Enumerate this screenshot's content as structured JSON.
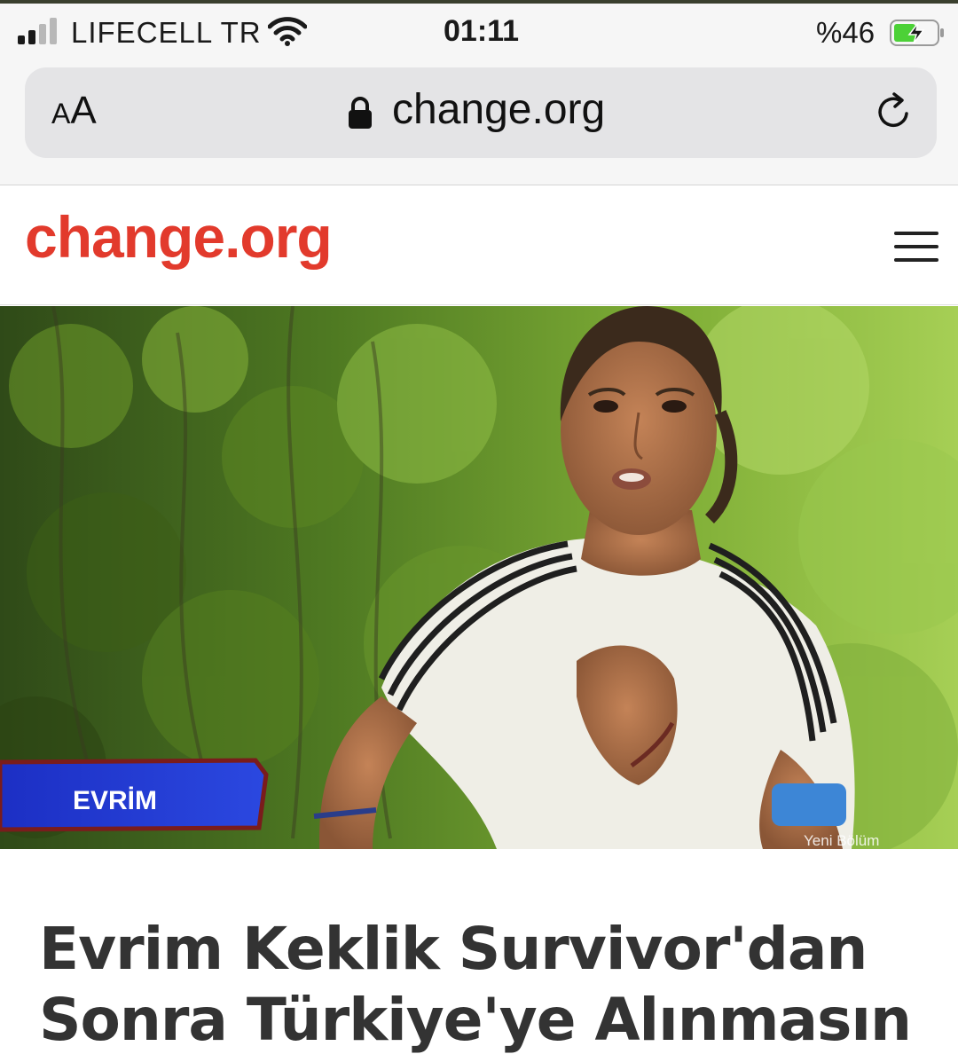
{
  "status_bar": {
    "carrier": "LIFECELL TR",
    "time": "01:11",
    "battery_percent": "%46",
    "icons": [
      "signal-icon",
      "wifi-icon",
      "battery-charging-icon"
    ]
  },
  "browser": {
    "text_size_label_small": "A",
    "text_size_label_large": "A",
    "domain": "change.org",
    "icons": [
      "lock-icon",
      "reload-icon"
    ]
  },
  "site": {
    "logo": "change.org",
    "logo_color": "#e23a2c",
    "menu_icon": "hamburger-menu-icon"
  },
  "hero": {
    "name_banner": "EVRİM",
    "watermark": "Yeni Bölüm"
  },
  "petition": {
    "title_line1": "Evrim Keklik Survivor'dan",
    "title_line2": "Sonra Türkiye'ye Alınmasın"
  }
}
